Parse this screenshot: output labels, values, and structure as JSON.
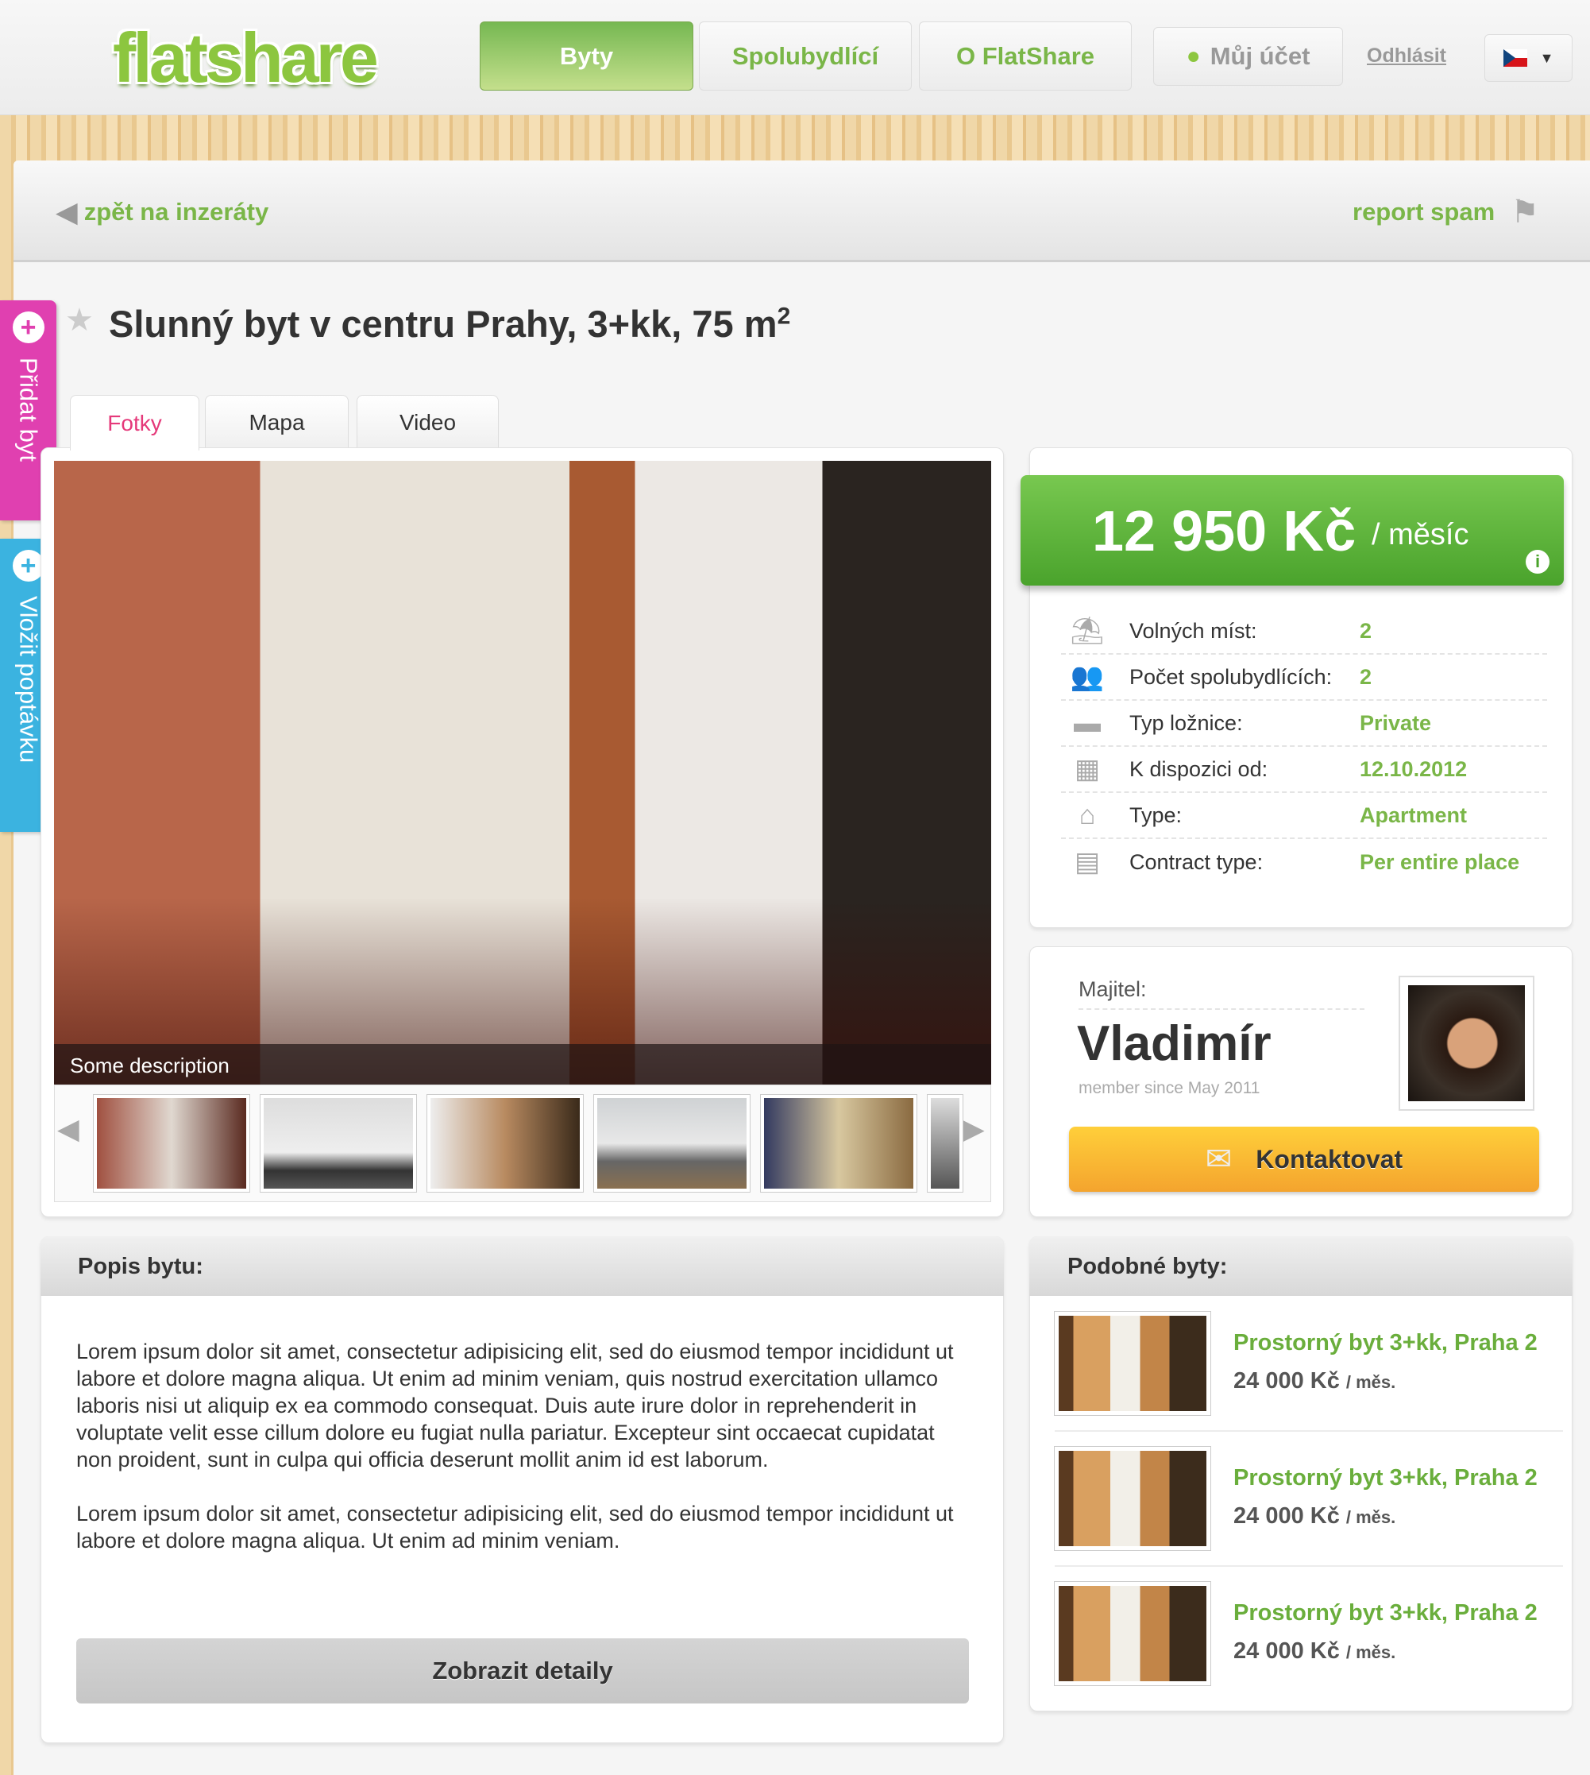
{
  "header": {
    "logo": "flatshare",
    "nav": [
      "Byty",
      "Spolubydlící",
      "O FlatShare"
    ],
    "account": "Můj účet",
    "logout": "Odhlásit",
    "language": "CZ"
  },
  "toolbar": {
    "back": "zpět na inzeráty",
    "report": "report spam"
  },
  "listing": {
    "title": "Slunný byt v centru Prahy, 3+kk, 75 m",
    "title_sup": "2"
  },
  "side_tabs": {
    "add_flat": "Přidat byt",
    "add_request": "Vložit poptávku"
  },
  "media_tabs": [
    "Fotky",
    "Mapa",
    "Video"
  ],
  "gallery": {
    "caption": "Some description",
    "thumb_count": 6
  },
  "price": {
    "amount": "12 950 Kč",
    "period": "/ měsíc"
  },
  "details": [
    {
      "icon": "lamp-icon",
      "label": "Volných míst:",
      "value": "2"
    },
    {
      "icon": "people-icon",
      "label": "Počet spolubydlících:",
      "value": "2"
    },
    {
      "icon": "bed-icon",
      "label": "Typ ložnice:",
      "value": "Private"
    },
    {
      "icon": "calendar-icon",
      "label": "K dispozici od:",
      "value": "12.10.2012"
    },
    {
      "icon": "house-icon",
      "label": "Type:",
      "value": "Apartment"
    },
    {
      "icon": "document-icon",
      "label": "Contract type:",
      "value": "Per entire place"
    }
  ],
  "owner": {
    "label": "Majitel:",
    "name": "Vladimír",
    "since": "member since May 2011",
    "contact": "Kontaktovat"
  },
  "description": {
    "heading": "Popis bytu:",
    "p1": "Lorem ipsum dolor sit amet, consectetur adipisicing elit, sed do eiusmod tempor incididunt ut labore et dolore magna aliqua. Ut enim ad minim veniam, quis nostrud exercitation ullamco laboris nisi ut aliquip ex ea commodo consequat. Duis aute irure dolor in reprehenderit in voluptate velit esse cillum dolore eu fugiat nulla pariatur. Excepteur sint occaecat cupidatat non proident, sunt in culpa qui officia deserunt mollit anim id est laborum.",
    "p2": "Lorem ipsum dolor sit amet, consectetur adipisicing elit, sed do eiusmod tempor incididunt ut labore et dolore magna aliqua. Ut enim ad minim veniam.",
    "button": "Zobrazit detaily"
  },
  "similar": {
    "heading": "Podobné byty:",
    "items": [
      {
        "title": "Prostorný byt 3+kk, Praha 2",
        "price": "24 000 Kč",
        "unit": "/ měs."
      },
      {
        "title": "Prostorný byt 3+kk, Praha 2",
        "price": "24 000 Kč",
        "unit": "/ měs."
      },
      {
        "title": "Prostorný byt 3+kk, Praha 2",
        "price": "24 000 Kč",
        "unit": "/ měs."
      }
    ]
  }
}
